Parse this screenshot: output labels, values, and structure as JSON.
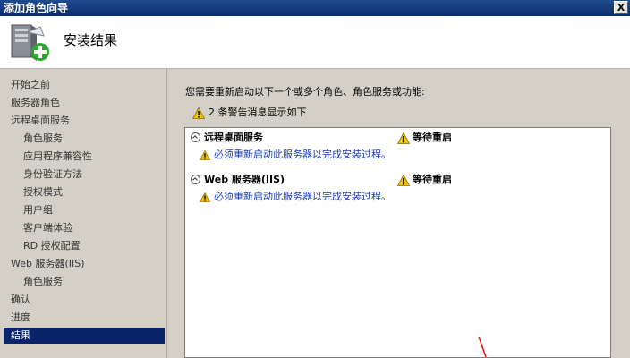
{
  "window": {
    "title": "添加角色向导",
    "close_label": "X"
  },
  "header": {
    "title": "安装结果"
  },
  "sidebar": {
    "items": [
      {
        "label": "开始之前",
        "indent": false,
        "active": false
      },
      {
        "label": "服务器角色",
        "indent": false,
        "active": false
      },
      {
        "label": "远程桌面服务",
        "indent": false,
        "active": false
      },
      {
        "label": "角色服务",
        "indent": true,
        "active": false
      },
      {
        "label": "应用程序兼容性",
        "indent": true,
        "active": false
      },
      {
        "label": "身份验证方法",
        "indent": true,
        "active": false
      },
      {
        "label": "授权模式",
        "indent": true,
        "active": false
      },
      {
        "label": "用户组",
        "indent": true,
        "active": false
      },
      {
        "label": "客户端体验",
        "indent": true,
        "active": false
      },
      {
        "label": "RD 授权配置",
        "indent": true,
        "active": false
      },
      {
        "label": "Web 服务器(IIS)",
        "indent": false,
        "active": false
      },
      {
        "label": "角色服务",
        "indent": true,
        "active": false
      },
      {
        "label": "确认",
        "indent": false,
        "active": false
      },
      {
        "label": "进度",
        "indent": false,
        "active": false
      },
      {
        "label": "结果",
        "indent": false,
        "active": true
      }
    ]
  },
  "main": {
    "instruction": "您需要重新启动以下一个或多个角色、角色服务或功能:",
    "warning_summary": "2 条警告消息显示如下",
    "results": [
      {
        "name": "远程桌面服务",
        "status": "等待重启",
        "message": "必须重新启动此服务器以完成安装过程。"
      },
      {
        "name": "Web 服务器(IIS)",
        "status": "等待重启",
        "message": "必须重新启动此服务器以完成安装过程。"
      }
    ]
  },
  "colors": {
    "titlebar": "#0a2c6b",
    "active_nav": "#0a246a",
    "message_text": "#1a3cb3",
    "warning": "#f2c200"
  }
}
